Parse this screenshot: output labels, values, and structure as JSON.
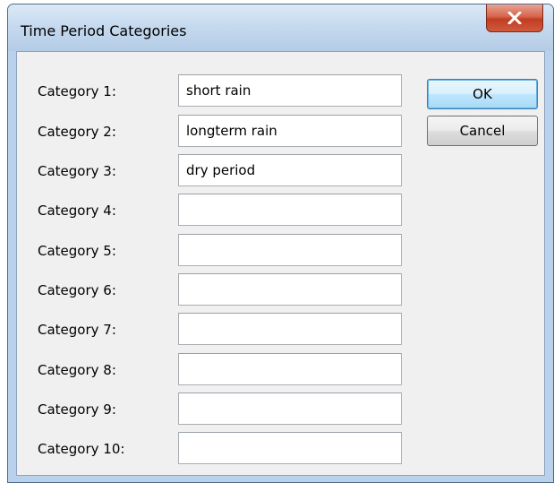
{
  "window": {
    "title": "Time Period Categories"
  },
  "categories": [
    {
      "label": "Category 1:",
      "value": "short rain"
    },
    {
      "label": "Category 2:",
      "value": "longterm rain"
    },
    {
      "label": "Category 3:",
      "value": "dry period"
    },
    {
      "label": "Category 4:",
      "value": ""
    },
    {
      "label": "Category 5:",
      "value": ""
    },
    {
      "label": "Category 6:",
      "value": ""
    },
    {
      "label": "Category 7:",
      "value": ""
    },
    {
      "label": "Category 8:",
      "value": ""
    },
    {
      "label": "Category 9:",
      "value": ""
    },
    {
      "label": "Category 10:",
      "value": ""
    }
  ],
  "buttons": {
    "ok_label": "OK",
    "cancel_label": "Cancel"
  },
  "icons": {
    "close": "close-icon"
  },
  "colors": {
    "title_bar": "#c6daef",
    "close_button": "#c94a30",
    "dialog_background": "#f0f0f0",
    "default_button_border": "#3c7fb1"
  }
}
